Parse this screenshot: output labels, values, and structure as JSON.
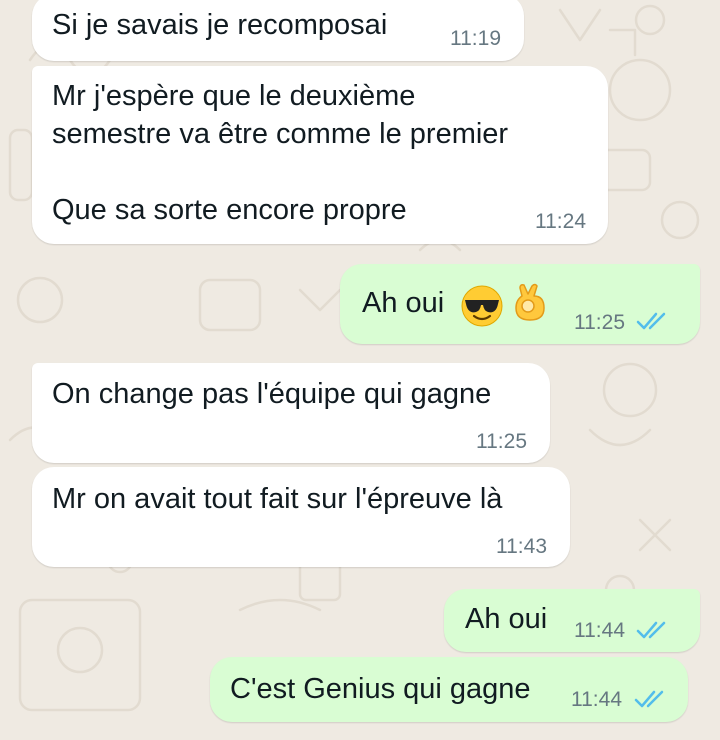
{
  "messages": [
    {
      "direction": "in",
      "text": "Si je savais je recomposai",
      "time": "11:19"
    },
    {
      "direction": "in",
      "text": "Mr j'espère que le deuxième\nsemestre va être comme le premier\n\nQue sa sorte encore propre",
      "time": "11:24"
    },
    {
      "direction": "out",
      "text": "Ah oui",
      "emoji": [
        "smiling-face-with-sunglasses",
        "ok-hand"
      ],
      "time": "11:25",
      "status": "read"
    },
    {
      "direction": "in",
      "text": "On change pas l'équipe qui gagne",
      "time": "11:25"
    },
    {
      "direction": "in",
      "text": "Mr on avait tout fait sur l'épreuve là",
      "time": "11:43"
    },
    {
      "direction": "out",
      "text": "Ah oui",
      "time": "11:44",
      "status": "read"
    },
    {
      "direction": "out",
      "text": "C'est Genius qui gagne",
      "time": "11:44",
      "status": "read"
    }
  ],
  "colors": {
    "background": "#efeae2",
    "incoming_bubble": "#ffffff",
    "outgoing_bubble": "#d9fdd3",
    "timestamp": "#667781",
    "read_ticks": "#53bdeb"
  }
}
